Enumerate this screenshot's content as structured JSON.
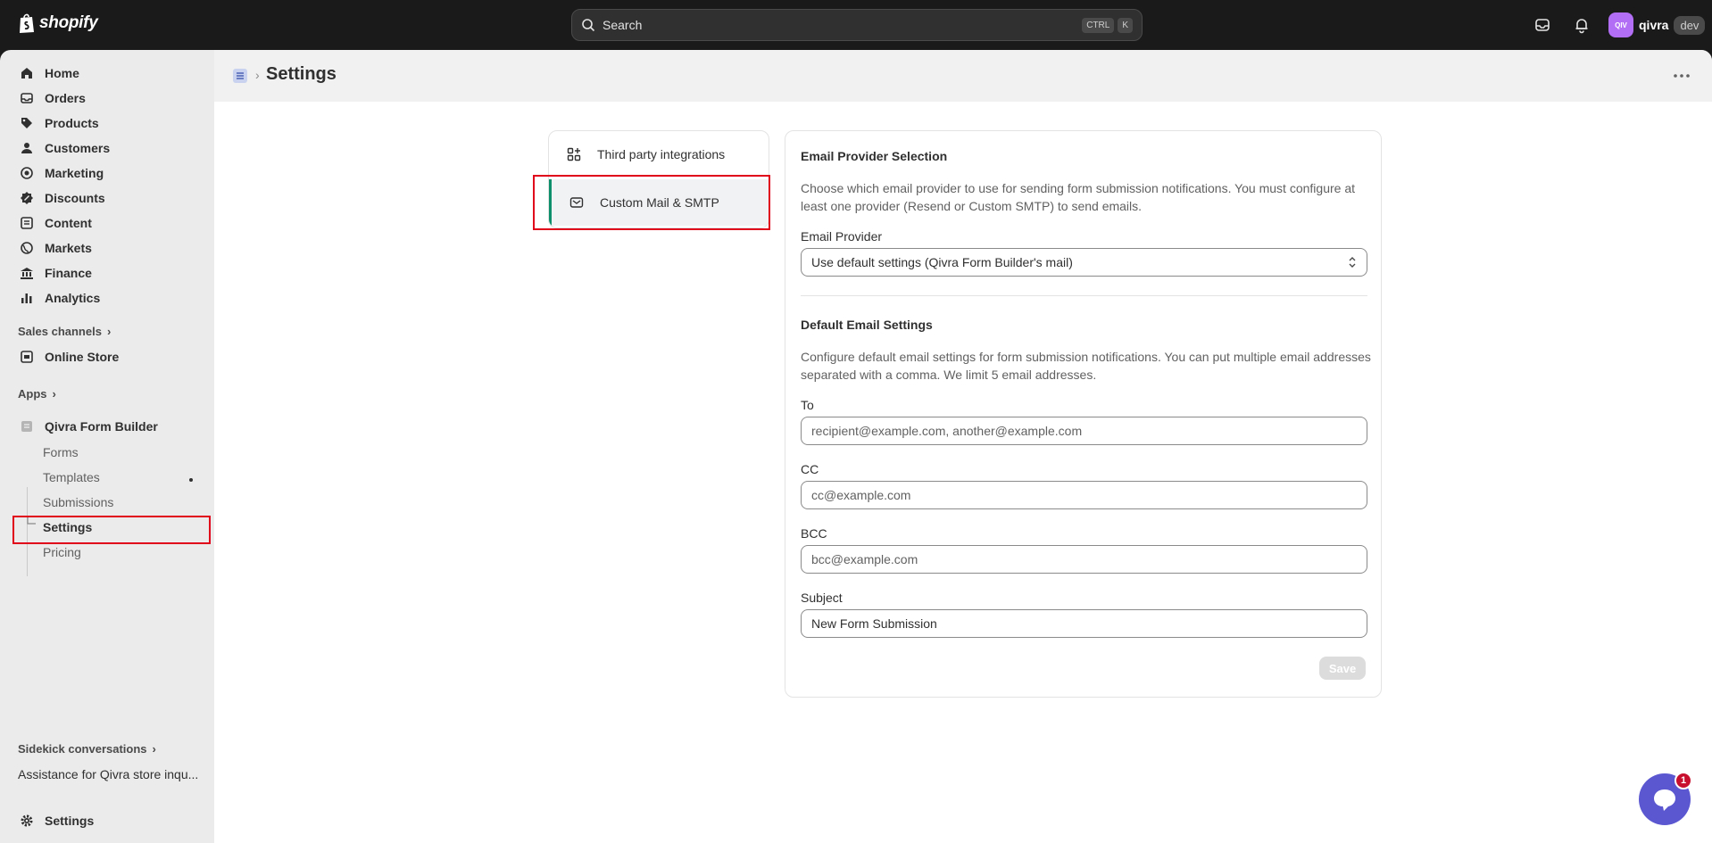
{
  "topbar": {
    "logo_text": "shopify",
    "search_placeholder": "Search",
    "kbd_ctrl": "CTRL",
    "kbd_k": "K",
    "account_avatar": "QIV",
    "account_name": "qivra",
    "account_badge": "dev"
  },
  "sidebar": {
    "items": [
      {
        "label": "Home",
        "icon": "home-icon"
      },
      {
        "label": "Orders",
        "icon": "inbox-icon"
      },
      {
        "label": "Products",
        "icon": "tag-icon"
      },
      {
        "label": "Customers",
        "icon": "person-icon"
      },
      {
        "label": "Marketing",
        "icon": "target-icon"
      },
      {
        "label": "Discounts",
        "icon": "discount-icon"
      },
      {
        "label": "Content",
        "icon": "content-icon"
      },
      {
        "label": "Markets",
        "icon": "globe-icon"
      },
      {
        "label": "Finance",
        "icon": "bank-icon"
      },
      {
        "label": "Analytics",
        "icon": "chart-icon"
      }
    ],
    "sales_channels": "Sales channels",
    "online_store": "Online Store",
    "apps": "Apps",
    "app_name": "Qivra Form Builder",
    "app_sub": [
      "Forms",
      "Templates",
      "Submissions",
      "Settings",
      "Pricing"
    ],
    "sidekick": "Sidekick conversations",
    "sidekick_item": "Assistance for Qivra store inqu...",
    "settings": "Settings"
  },
  "header": {
    "title": "Settings"
  },
  "tabs": [
    {
      "label": "Third party integrations",
      "icon": "apps-icon"
    },
    {
      "label": "Custom Mail & SMTP",
      "icon": "mail-icon"
    }
  ],
  "form": {
    "provider_heading": "Email Provider Selection",
    "provider_desc": "Choose which email provider to use for sending form submission notifications. You must configure at least one provider (Resend or Custom SMTP) to send emails.",
    "provider_label": "Email Provider",
    "provider_value": "Use default settings (Qivra Form Builder's mail)",
    "default_heading": "Default Email Settings",
    "default_desc": "Configure default email settings for form submission notifications. You can put multiple email addresses separated with a comma. We limit 5 email addresses.",
    "to_label": "To",
    "to_placeholder": "recipient@example.com, another@example.com",
    "cc_label": "CC",
    "cc_placeholder": "cc@example.com",
    "bcc_label": "BCC",
    "bcc_placeholder": "bcc@example.com",
    "subject_label": "Subject",
    "subject_value": "New Form Submission",
    "save_label": "Save"
  },
  "chat": {
    "badge": "1"
  },
  "colors": {
    "highlight": "#e0001a",
    "active_tab_accent": "#0e8f6c",
    "chat": "#5b57d1"
  }
}
